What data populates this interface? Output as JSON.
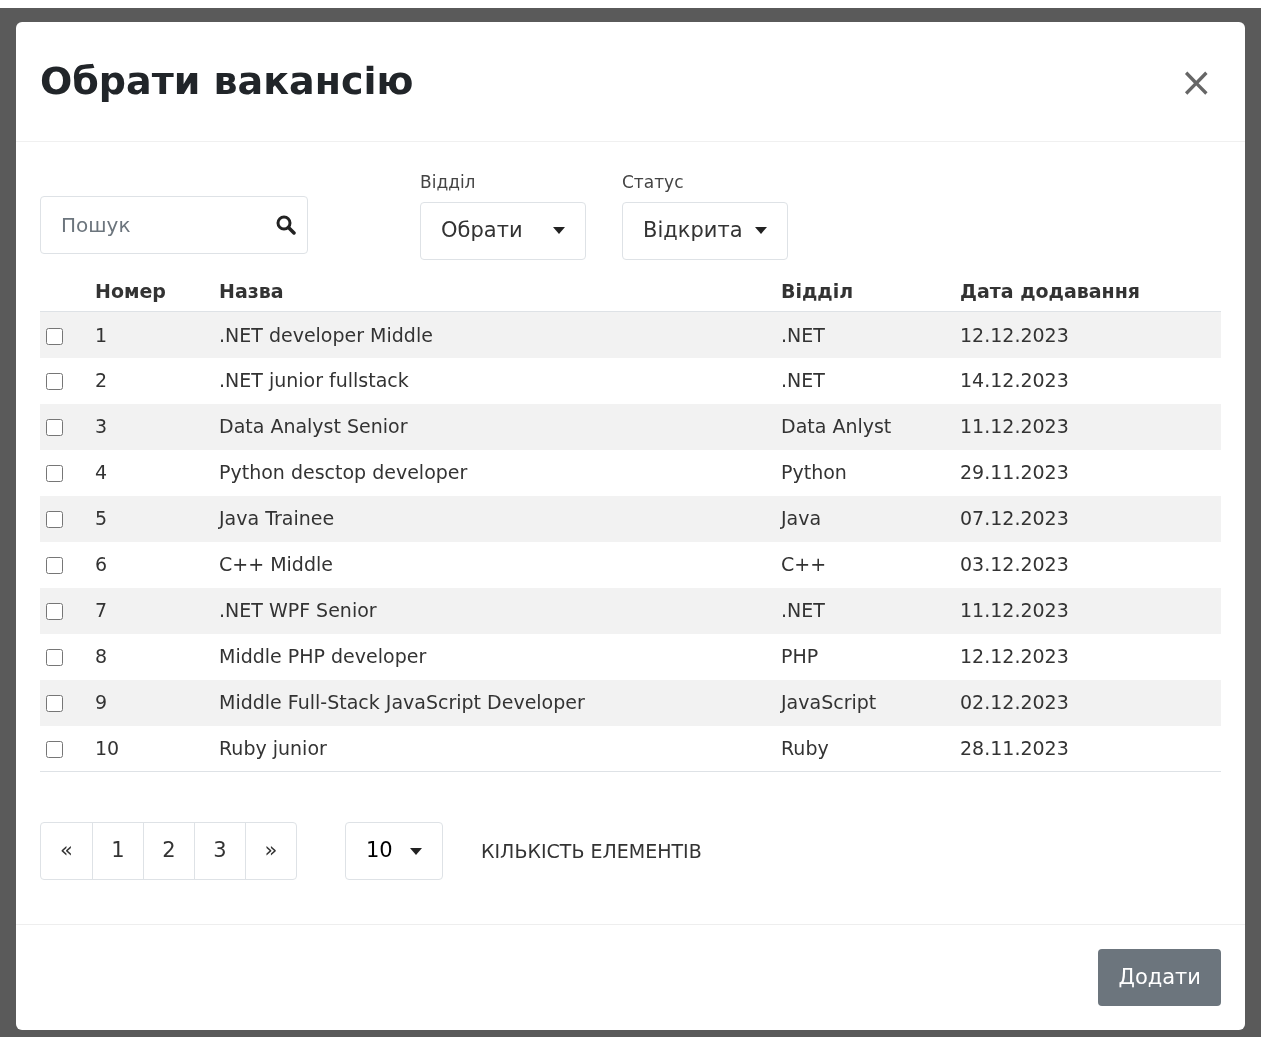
{
  "modal": {
    "title": "Обрати вакансію",
    "close": "×"
  },
  "search": {
    "placeholder": "Пошук"
  },
  "filters": [
    {
      "label": "Відділ",
      "value": "Обрати"
    },
    {
      "label": "Статус",
      "value": "Відкрита"
    }
  ],
  "table": {
    "columns": [
      "Номер",
      "Назва",
      "Відділ",
      "Дата додавання"
    ],
    "rows": [
      {
        "checked": false,
        "cells": [
          "1",
          ".NET developer Middle",
          ".NET",
          "12.12.2023"
        ]
      },
      {
        "checked": false,
        "cells": [
          "2",
          ".NET junior fullstack",
          ".NET",
          "14.12.2023"
        ]
      },
      {
        "checked": false,
        "cells": [
          "3",
          "Data Analyst Senior",
          "Data Anlyst",
          "11.12.2023"
        ]
      },
      {
        "checked": false,
        "cells": [
          "4",
          "Python desctop developer",
          "Python",
          "29.11.2023"
        ]
      },
      {
        "checked": false,
        "cells": [
          "5",
          "Java Trainee",
          "Java",
          "07.12.2023"
        ]
      },
      {
        "checked": false,
        "cells": [
          "6",
          "C++ Middle",
          "C++",
          "03.12.2023"
        ]
      },
      {
        "checked": false,
        "cells": [
          "7",
          ".NET WPF Senior",
          ".NET",
          "11.12.2023"
        ]
      },
      {
        "checked": false,
        "cells": [
          "8",
          "Middle PHP developer",
          "PHP",
          "12.12.2023"
        ]
      },
      {
        "checked": false,
        "cells": [
          "9",
          "Middle Full-Stack JavaScript Developer",
          "JavaScript",
          "02.12.2023"
        ]
      },
      {
        "checked": false,
        "cells": [
          "10",
          "Ruby junior",
          "Ruby",
          "28.11.2023"
        ]
      }
    ]
  },
  "pagination": {
    "items": [
      "«",
      "1",
      "2",
      "3",
      "»"
    ],
    "page_size": "10",
    "page_size_label": "КІЛЬКІСТЬ ЕЛЕМЕНТІВ"
  },
  "footer": {
    "button": "Додати"
  }
}
